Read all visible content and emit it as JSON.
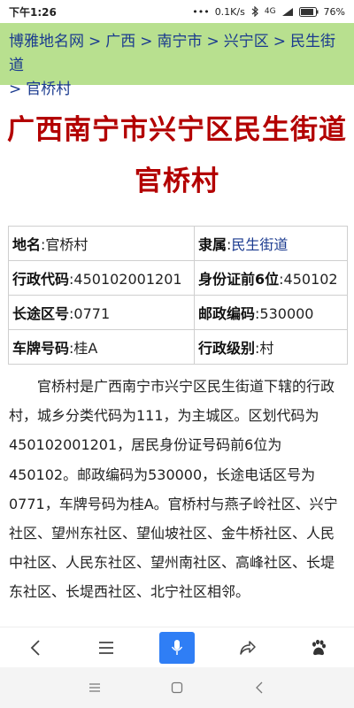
{
  "status_bar": {
    "time": "下午1:26",
    "speed": "0.1K/s",
    "network": "4G",
    "battery": "76%"
  },
  "breadcrumb": {
    "items": [
      "博雅地名网",
      "广西",
      "南宁市",
      "兴宁区",
      "民生街道",
      "官桥村"
    ],
    "separator": ">"
  },
  "page": {
    "title_line1": "广西南宁市兴宁区民生街道",
    "title_line2": "官桥村",
    "title_color": "#b30000"
  },
  "info_table": {
    "rows": [
      [
        {
          "key": "地名",
          "value": "官桥村"
        },
        {
          "key": "隶属",
          "value": "民生街道"
        }
      ],
      [
        {
          "key": "行政代码",
          "value": "450102001201"
        },
        {
          "key": "身份证前6位",
          "value": "450102"
        }
      ],
      [
        {
          "key": "长途区号",
          "value": "0771"
        },
        {
          "key": "邮政编码",
          "value": "530000"
        }
      ],
      [
        {
          "key": "车牌号码",
          "value": "桂A"
        },
        {
          "key": "行政级别",
          "value": "村"
        }
      ]
    ]
  },
  "description": "官桥村是广西南宁市兴宁区民生街道下辖的行政村，城乡分类代码为111，为主城区。区划代码为450102001201，居民身份证号码前6位为450102。邮政编码为530000，长途电话区号为0771，车牌号码为桂A。官桥村与燕子岭社区、兴宁社区、望州东社区、望仙坡社区、金牛桥社区、人民中社区、人民东社区、望州南社区、高峰社区、长堤东社区、长堤西社区、北宁社区相邻。",
  "nav_bar": {
    "icons": [
      "back-icon",
      "menu-icon",
      "microphone-icon",
      "share-icon",
      "baidu-paw-icon"
    ],
    "accent": "#2f7ef5"
  },
  "system_nav": {
    "icons": [
      "recent-apps-icon",
      "home-icon",
      "system-back-icon"
    ]
  }
}
